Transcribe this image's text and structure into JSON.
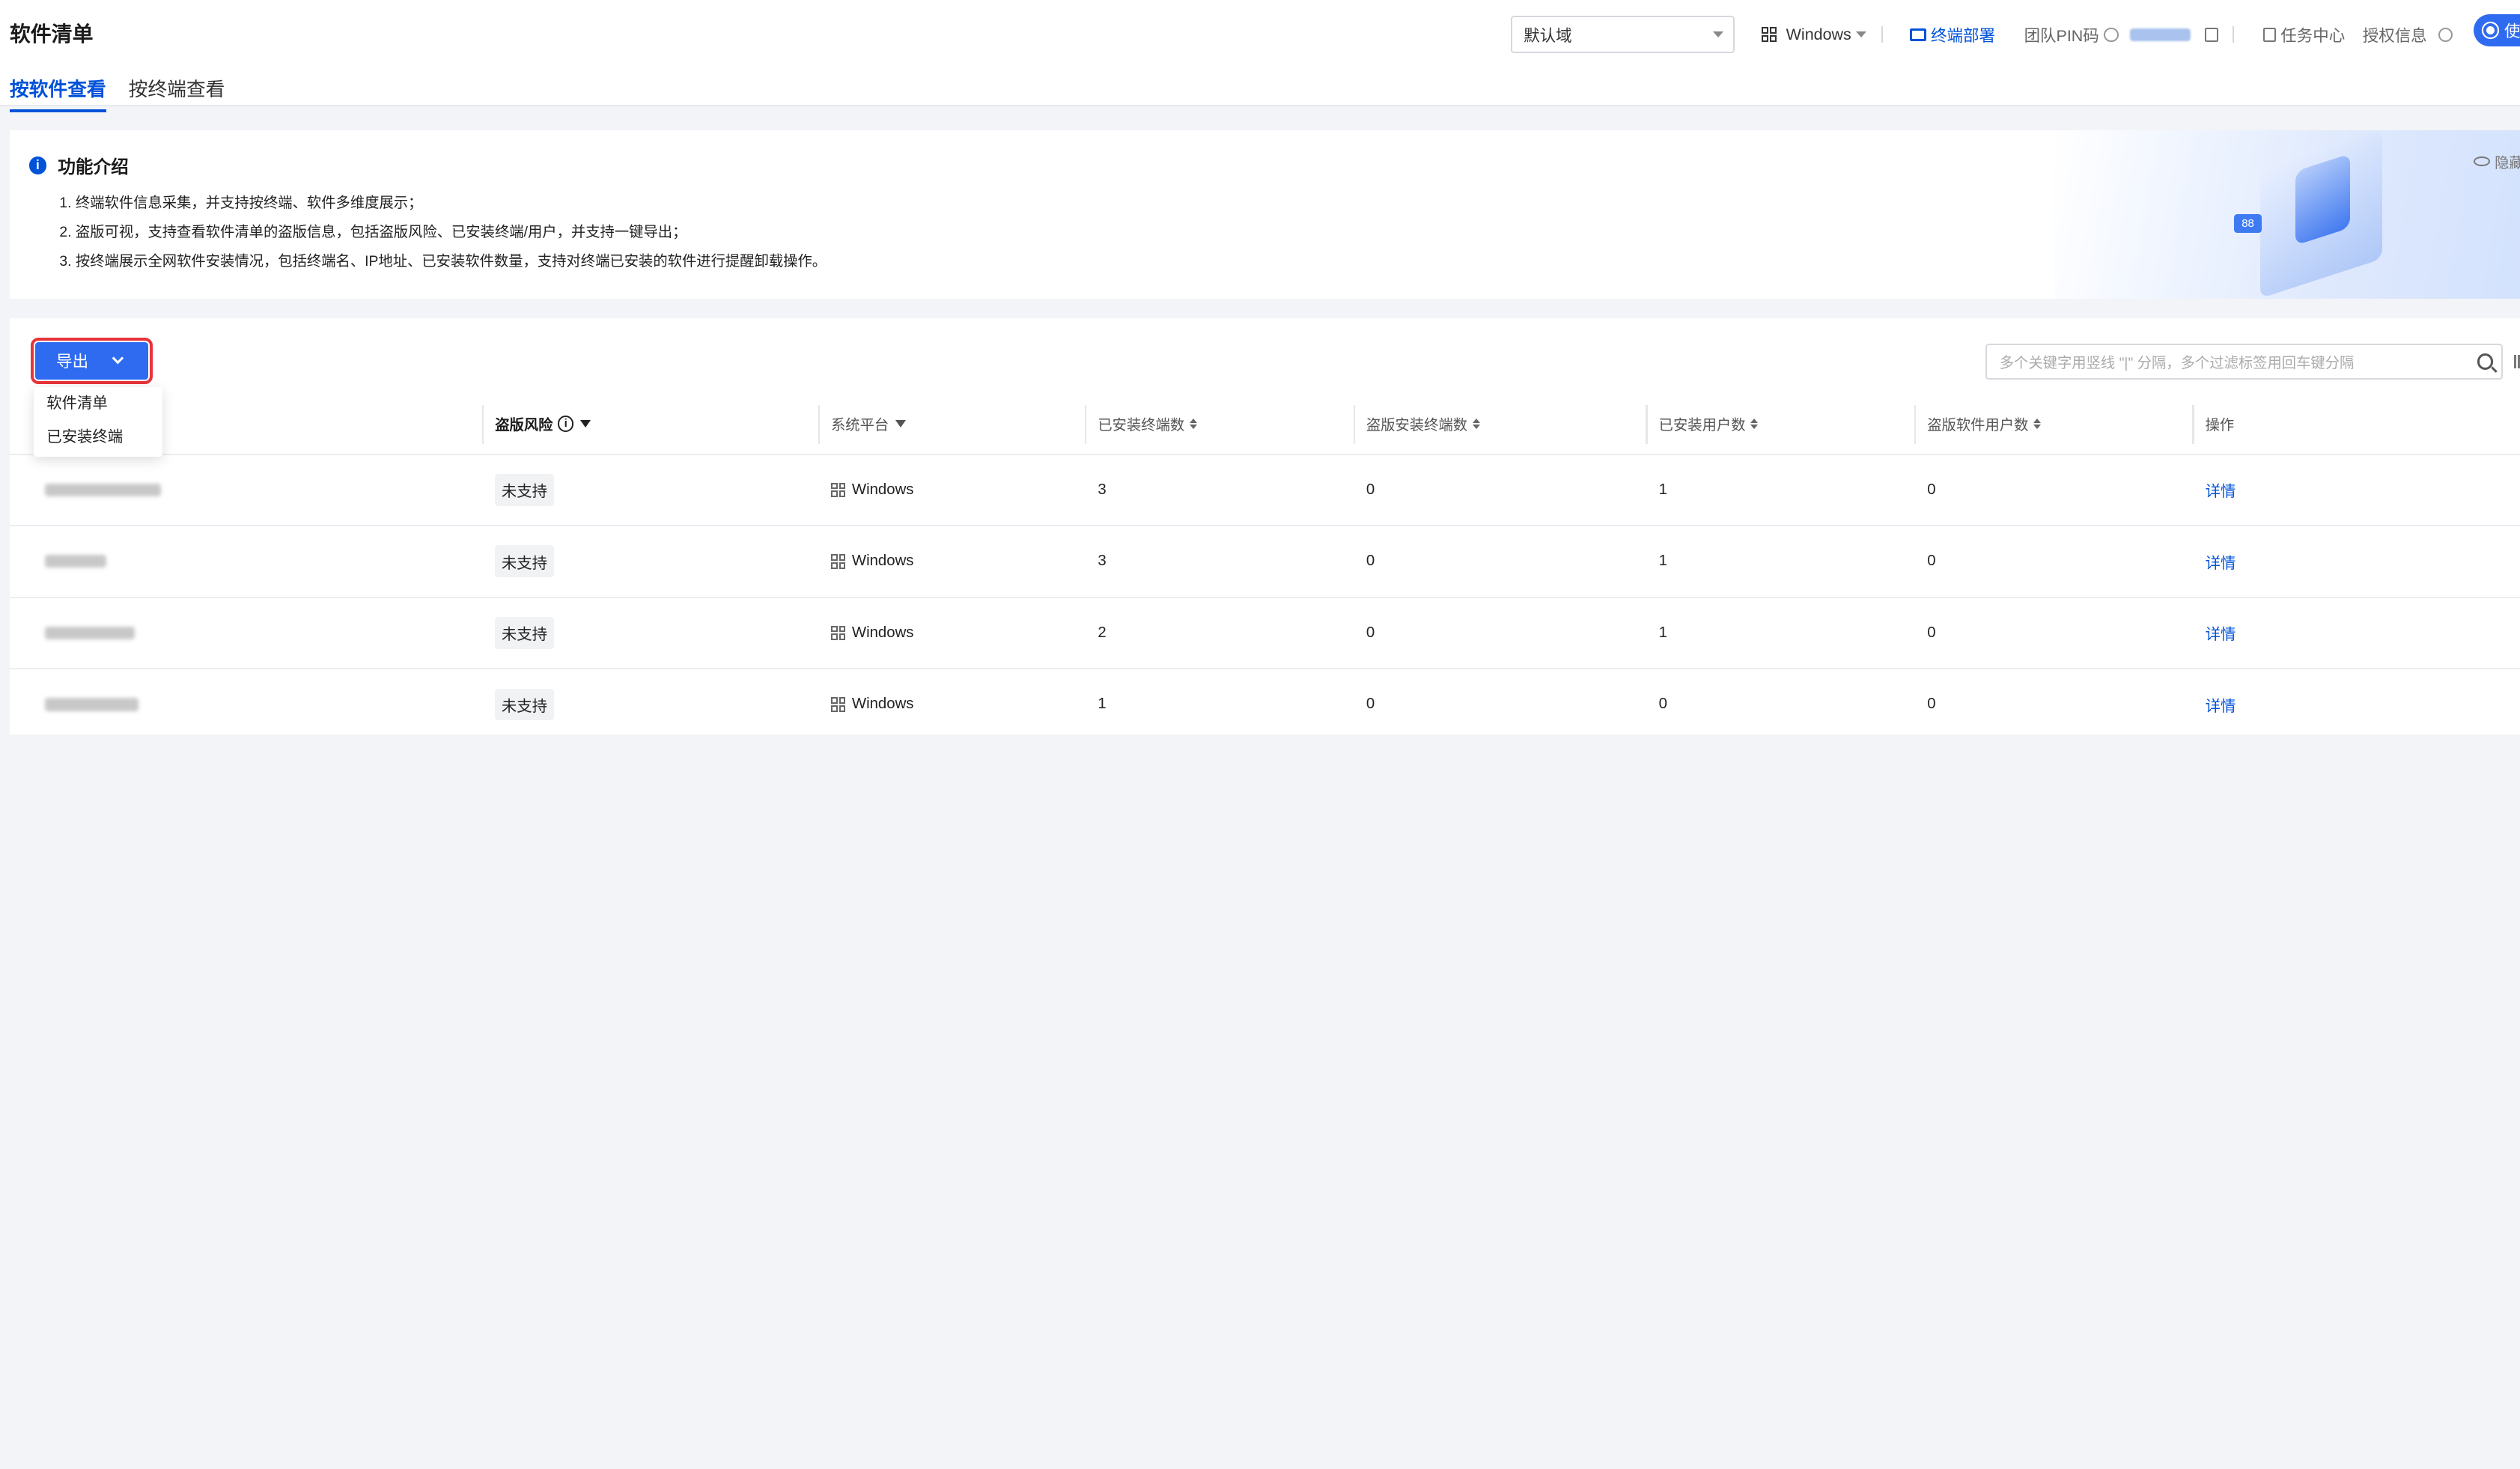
{
  "header": {
    "title": "软件清单",
    "tabs": [
      {
        "label": "按软件查看",
        "active": true
      },
      {
        "label": "按终端查看",
        "active": false
      }
    ],
    "domain_select": "默认域",
    "os_select": "Windows",
    "deploy_label": "终端部署",
    "pin_label": "团队PIN码",
    "tasks_label": "任务中心",
    "auth_label": "授权信息",
    "use_label": "使"
  },
  "intro": {
    "title": "功能介绍",
    "hide_label": "隐藏",
    "lines": [
      "1. 终端软件信息采集，并支持按终端、软件多维度展示；",
      "2. 盗版可视，支持查看软件清单的盗版信息，包括盗版风险、已安装终端/用户，并支持一键导出；",
      "3. 按终端展示全网软件安装情况，包括终端名、IP地址、已安装软件数量，支持对终端已安装的软件进行提醒卸载操作。"
    ],
    "deco_tag": "88"
  },
  "toolbar": {
    "export_label": "导出",
    "export_menu": [
      "软件清单",
      "已安装终端"
    ],
    "search_placeholder": "多个关键字用竖线 \"|\" 分隔，多个过滤标签用回车键分隔"
  },
  "table": {
    "columns": [
      "",
      "盗版风险",
      "系统平台",
      "已安装终端数",
      "盗版安装终端数",
      "已安装用户数",
      "盗版软件用户数",
      "操作"
    ],
    "rows": [
      {
        "risk": "未支持",
        "platform": "Windows",
        "installed_terminals": "3",
        "pirated_terminals": "0",
        "installed_users": "1",
        "pirated_users": "0",
        "action": "详情"
      },
      {
        "risk": "未支持",
        "platform": "Windows",
        "installed_terminals": "3",
        "pirated_terminals": "0",
        "installed_users": "1",
        "pirated_users": "0",
        "action": "详情"
      },
      {
        "risk": "未支持",
        "platform": "Windows",
        "installed_terminals": "2",
        "pirated_terminals": "0",
        "installed_users": "1",
        "pirated_users": "0",
        "action": "详情"
      },
      {
        "risk": "未支持",
        "platform": "Windows",
        "installed_terminals": "1",
        "pirated_terminals": "0",
        "installed_users": "0",
        "pirated_users": "0",
        "action": "详情"
      }
    ]
  },
  "colors": {
    "accent": "#0052d9",
    "button": "#2f6bf0",
    "highlight_outline": "#e8343a"
  }
}
